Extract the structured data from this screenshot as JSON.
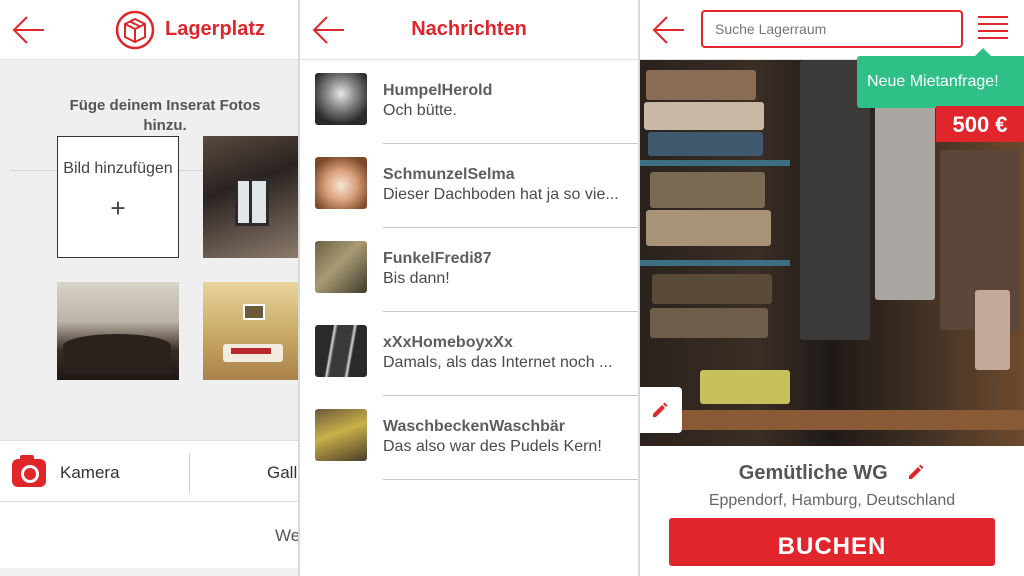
{
  "screen_upload": {
    "title": "Lagerplatz",
    "hint": "Füge deinem Inserat Fotos hinzu.",
    "add_image_label": "Bild hinzufügen",
    "add_plus": "+",
    "camera_label": "Kamera",
    "gallery_label": "Galle",
    "next_label": "We"
  },
  "screen_messages": {
    "title": "Nachrichten",
    "messages": [
      {
        "name": "HumpelHerold",
        "text": "Och bütte."
      },
      {
        "name": "SchmunzelSelma",
        "text": "Dieser Dachboden hat ja so vie..."
      },
      {
        "name": "FunkelFredi87",
        "text": "Bis dann!"
      },
      {
        "name": "xXxHomeboyxXx",
        "text": "Damals, als das Internet noch ..."
      },
      {
        "name": "WaschbeckenWaschbär",
        "text": "Das also war des Pudels Kern!"
      }
    ]
  },
  "screen_listing": {
    "search_placeholder": "Suche Lagerraum",
    "toast": "Neue Mietanfrage!",
    "price": "500 €",
    "title": "Gemütliche WG",
    "location": "Eppendorf, Hamburg, Deutschland",
    "book_label": "BUCHEN"
  },
  "colors": {
    "accent": "#e0262b",
    "toast": "#2ec086"
  }
}
